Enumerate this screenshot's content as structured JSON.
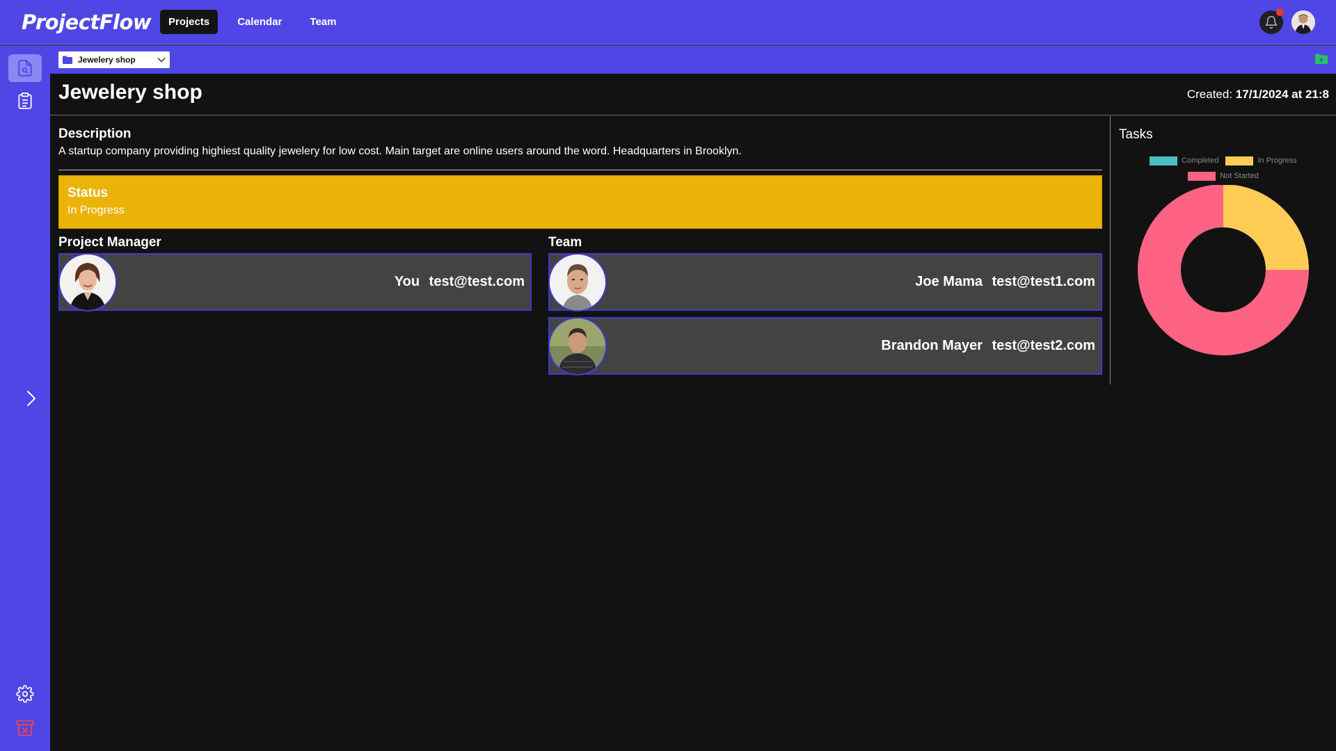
{
  "app": {
    "logo": "ProjectFlow"
  },
  "nav": {
    "links": [
      {
        "label": "Projects",
        "active": true
      },
      {
        "label": "Calendar",
        "active": false
      },
      {
        "label": "Team",
        "active": false
      }
    ]
  },
  "toolbar": {
    "project_select_value": "Jewelery shop"
  },
  "project": {
    "title": "Jewelery shop",
    "created_label": "Created:",
    "created_value": "17/1/2024 at 21:8",
    "description_title": "Description",
    "description": "A startup company providing highiest quality jewelery for low cost. Main target are online users around the word. Headquarters in Brooklyn.",
    "status_title": "Status",
    "status": "In Progress",
    "status_color": "#eab308"
  },
  "manager": {
    "section_title": "Project Manager",
    "name": "You",
    "email": "test@test.com"
  },
  "team": {
    "section_title": "Team",
    "members": [
      {
        "name": "Joe Mama",
        "email": "test@test1.com"
      },
      {
        "name": "Brandon Mayer",
        "email": "test@test2.com"
      }
    ]
  },
  "colors": {
    "accent": "#4f46e5",
    "background": "#121212",
    "card": "#434343"
  },
  "chart_data": {
    "type": "pie",
    "variant": "doughnut",
    "title": "Tasks",
    "legend_position": "top",
    "categories": [
      "Completed",
      "In Progress",
      "Not Started"
    ],
    "values": [
      0,
      1,
      3
    ],
    "colors": [
      "#4bc0c0",
      "#ffcd56",
      "#ff6384"
    ]
  }
}
